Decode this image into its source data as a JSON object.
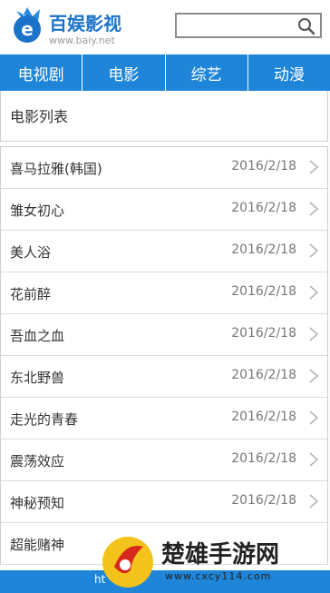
{
  "header": {
    "logo_text": "百娱影视",
    "logo_url": "www.baiy.net",
    "search_placeholder": ""
  },
  "nav": {
    "items": [
      {
        "label": "电视剧"
      },
      {
        "label": "电影"
      },
      {
        "label": "综艺"
      },
      {
        "label": "动漫"
      }
    ]
  },
  "section": {
    "title": "电影列表"
  },
  "list": [
    {
      "title": "喜马拉雅(韩国)",
      "date": "2016/2/18"
    },
    {
      "title": "雏女初心",
      "date": "2016/2/18"
    },
    {
      "title": "美人浴",
      "date": "2016/2/18"
    },
    {
      "title": "花前醉",
      "date": "2016/2/18"
    },
    {
      "title": "吾血之血",
      "date": "2016/2/18"
    },
    {
      "title": "东北野兽",
      "date": "2016/2/18"
    },
    {
      "title": "走光的青春",
      "date": "2016/2/18"
    },
    {
      "title": "震荡效应",
      "date": "2016/2/18"
    },
    {
      "title": "神秘预知",
      "date": "2016/2/18"
    },
    {
      "title": "超能赌神",
      "date": ""
    }
  ],
  "footer": {
    "text": "ht"
  },
  "watermark": {
    "text": "楚雄手游网",
    "url": "www.cxcy114.com"
  },
  "colors": {
    "brand_blue": "#1e85d8",
    "logo_blue": "#1b73c9"
  }
}
